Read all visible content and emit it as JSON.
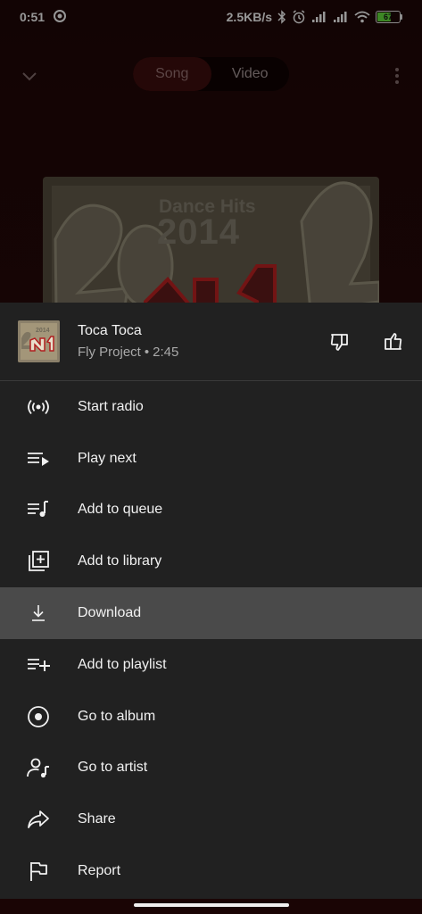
{
  "status_bar": {
    "time": "0:51",
    "speed": "2.5KB/s",
    "battery": "67",
    "battery_level": 0.67,
    "battery_color": "#5fcf3a"
  },
  "player": {
    "tabs": [
      {
        "label": "Song",
        "active": true
      },
      {
        "label": "Video",
        "active": false
      }
    ],
    "artwork": {
      "line1": "Dance Hits",
      "line2": "2014"
    }
  },
  "sheet": {
    "song": {
      "title": "Toca Toca",
      "artist": "Fly Project",
      "separator": "•",
      "duration": "2:45"
    },
    "items": [
      {
        "label": "Start radio",
        "icon": "radio-icon"
      },
      {
        "label": "Play next",
        "icon": "play-next-icon"
      },
      {
        "label": "Add to queue",
        "icon": "queue-music-icon"
      },
      {
        "label": "Add to library",
        "icon": "library-add-icon"
      },
      {
        "label": "Download",
        "icon": "download-icon",
        "highlighted": true
      },
      {
        "label": "Add to playlist",
        "icon": "playlist-add-icon"
      },
      {
        "label": "Go to album",
        "icon": "album-icon"
      },
      {
        "label": "Go to artist",
        "icon": "artist-icon"
      },
      {
        "label": "Share",
        "icon": "share-icon"
      },
      {
        "label": "Report",
        "icon": "flag-icon"
      }
    ]
  },
  "colors": {
    "sheet_bg": "#212121",
    "highlight_bg": "#4a4a4a",
    "player_bg": "#1d0707"
  }
}
